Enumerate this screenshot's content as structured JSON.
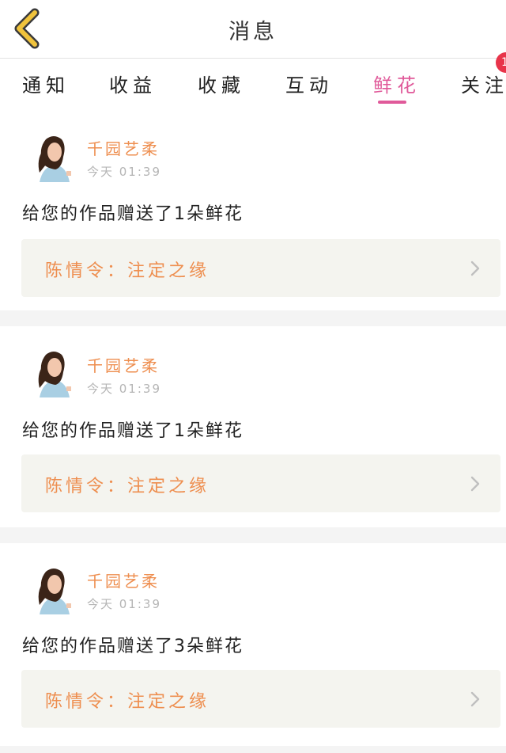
{
  "header": {
    "title": "消息",
    "back_icon": "chevron-left-icon"
  },
  "tabs": [
    {
      "label": "通知",
      "active": false
    },
    {
      "label": "收益",
      "active": false
    },
    {
      "label": "收藏",
      "active": false
    },
    {
      "label": "互动",
      "active": false
    },
    {
      "label": "鲜花",
      "active": true
    },
    {
      "label": "关注",
      "active": false,
      "badge": "1"
    }
  ],
  "messages": [
    {
      "sender": "千园艺柔",
      "timestamp": "今天 01:39",
      "text": "给您的作品赠送了1朵鲜花",
      "work_title": "陈情令：注定之缘",
      "chevron_icon": "chevron-right-icon"
    },
    {
      "sender": "千园艺柔",
      "timestamp": "今天 01:39",
      "text": "给您的作品赠送了1朵鲜花",
      "work_title": "陈情令：注定之缘",
      "chevron_icon": "chevron-right-icon"
    },
    {
      "sender": "千园艺柔",
      "timestamp": "今天 01:39",
      "text": "给您的作品赠送了3朵鲜花",
      "work_title": "陈情令：注定之缘",
      "chevron_icon": "chevron-right-icon"
    }
  ],
  "colors": {
    "accent_active_tab": "#e05a9a",
    "sender_name": "#ee8e4f",
    "work_title": "#ee8e4f",
    "badge": "#e8344a",
    "back_arrow": "#f0c33c"
  }
}
